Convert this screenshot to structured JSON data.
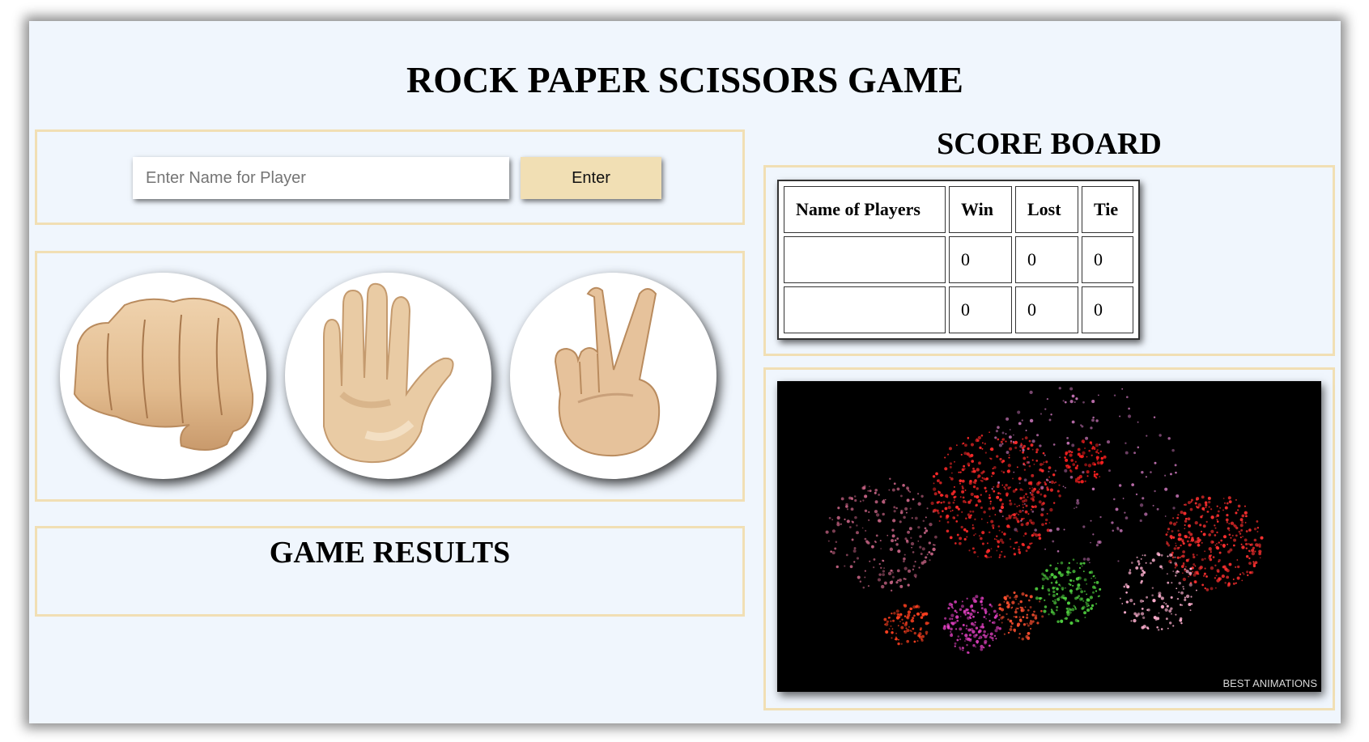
{
  "game": {
    "title": "ROCK PAPER SCISSORS GAME",
    "name_input": {
      "placeholder": "Enter Name for Player",
      "value": ""
    },
    "enter_label": "Enter",
    "choices": [
      {
        "id": "rock",
        "icon": "fist-icon"
      },
      {
        "id": "paper",
        "icon": "raised-hand-icon"
      },
      {
        "id": "scissors",
        "icon": "victory-hand-icon"
      }
    ],
    "results_title": "GAME RESULTS",
    "results_text": ""
  },
  "scoreboard": {
    "title": "SCORE BOARD",
    "headers": [
      "Name of Players",
      "Win",
      "Lost",
      "Tie"
    ],
    "rows": [
      {
        "name": "",
        "win": "0",
        "lost": "0",
        "tie": "0"
      },
      {
        "name": "",
        "win": "0",
        "lost": "0",
        "tie": "0"
      }
    ]
  },
  "animation": {
    "watermark": "BEST ANIMATIONS",
    "icon": "fireworks-icon"
  },
  "colors": {
    "background": "#f0f6fd",
    "accent": "#f1dfb4",
    "skin": "#e6c29b"
  }
}
